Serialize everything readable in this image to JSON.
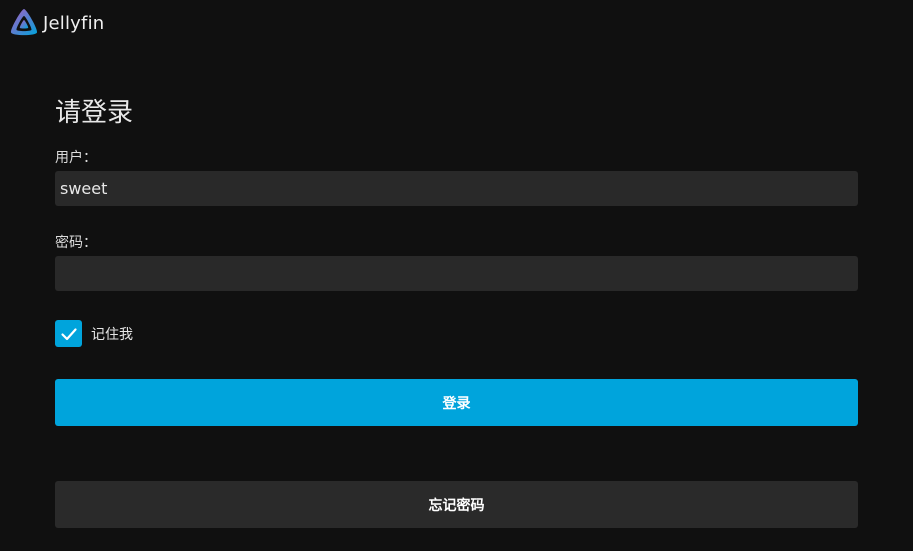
{
  "app": {
    "logo_icon": "jellyfin-logo-icon",
    "name": "Jellyfin"
  },
  "login": {
    "title": "请登录",
    "user_label": "用户：",
    "user_value": "sweet",
    "password_label": "密码：",
    "password_value": "",
    "remember_label": "记住我",
    "remember_checked": true,
    "login_button": "登录",
    "forgot_button": "忘记密码"
  },
  "colors": {
    "accent": "#00a4dc",
    "background": "#101010",
    "input_bg": "#292929",
    "secondary_button": "#2a2a2a"
  }
}
